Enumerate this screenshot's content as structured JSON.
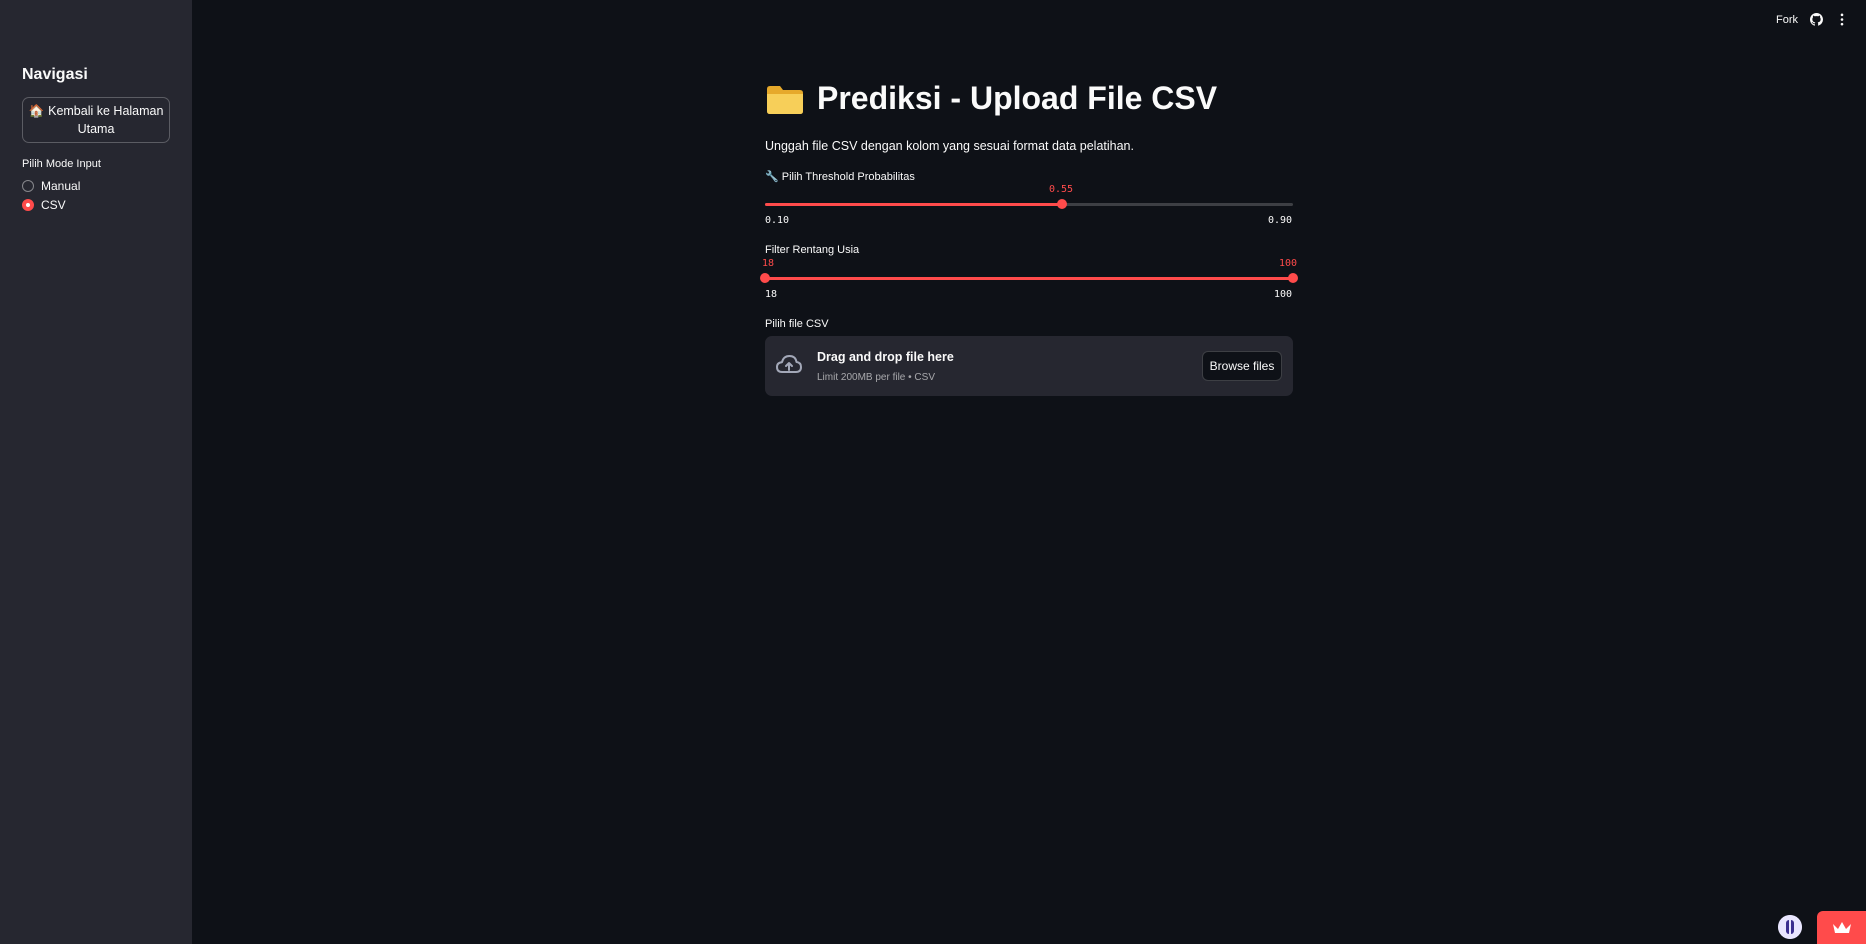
{
  "sidebar": {
    "title": "Navigasi",
    "home_button": {
      "icon": "🏠",
      "label": "Kembali ke Halaman Utama"
    },
    "mode_label": "Pilih Mode Input",
    "modes": [
      {
        "label": "Manual",
        "selected": false
      },
      {
        "label": "CSV",
        "selected": true
      }
    ]
  },
  "topbar": {
    "fork_label": "Fork",
    "github_icon": "github-icon",
    "menu_icon": "more-vertical-icon"
  },
  "main": {
    "title": "Prediksi - Upload File CSV",
    "title_icon": "folder-icon",
    "subtitle": "Unggah file CSV dengan kolom yang sesuai format data pelatihan.",
    "threshold": {
      "label": "🔧 Pilih Threshold Probabilitas",
      "value": "0.55",
      "min": "0.10",
      "max": "0.90"
    },
    "age": {
      "label": "Filter Rentang Usia",
      "low": "18",
      "high": "100",
      "min": "18",
      "max": "100"
    },
    "upload": {
      "label": "Pilih file CSV",
      "drag_text": "Drag and drop file here",
      "limit_text": "Limit 200MB per file • CSV",
      "browse_label": "Browse files"
    }
  },
  "colors": {
    "accent": "#ff4b4b",
    "background": "#0e1117",
    "sidebar": "#262730"
  }
}
